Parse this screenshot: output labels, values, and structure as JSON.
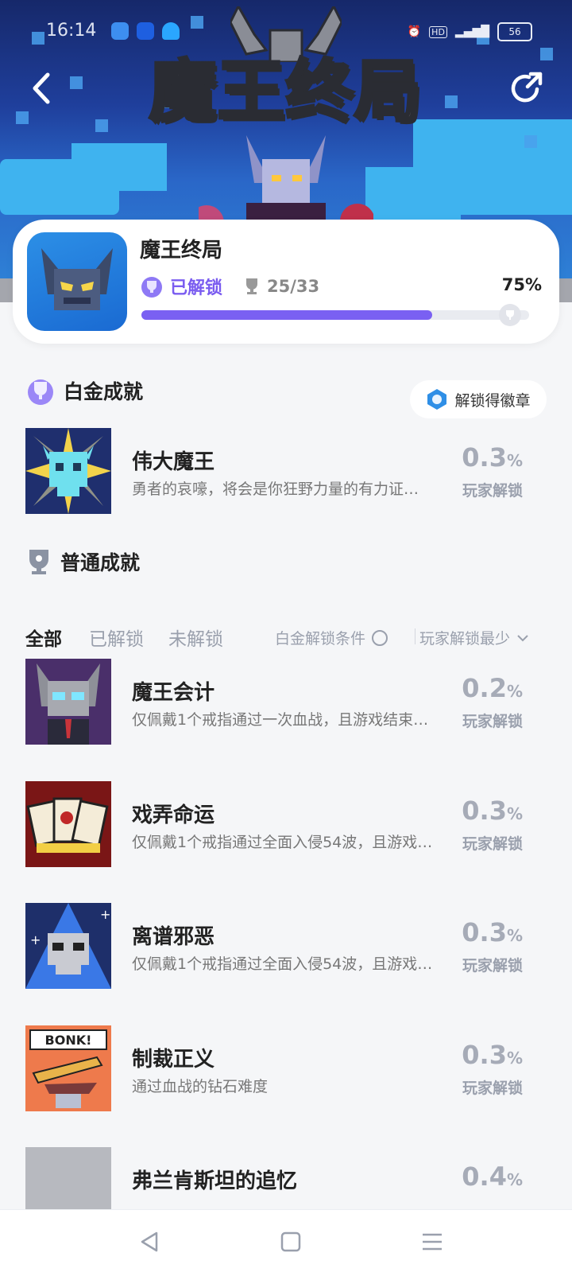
{
  "status_bar": {
    "time": "16:14",
    "battery": "56"
  },
  "hero": {
    "logo_text": "魔王终局"
  },
  "game": {
    "title": "魔王终局",
    "unlocked_label": "已解锁",
    "trophy_count": "25/33",
    "percent": "75%",
    "progress": 0.75
  },
  "platinum": {
    "heading": "白金成就",
    "badge_button": "解锁得徽章",
    "item": {
      "name": "伟大魔王",
      "desc": "勇者的哀嚎，将会是你狂野力量的有力证…",
      "rate": "0.3",
      "rate_unit": "%",
      "rate_label": "玩家解锁"
    }
  },
  "normal": {
    "heading": "普通成就",
    "tabs": [
      "全部",
      "已解锁",
      "未解锁"
    ],
    "filter_condition": "白金解锁条件",
    "sort": "玩家解锁最少",
    "items": [
      {
        "name": "魔王会计",
        "desc": "仅佩戴1个戒指通过一次血战，且游戏结束…",
        "rate": "0.2",
        "rate_unit": "%",
        "rate_label": "玩家解锁"
      },
      {
        "name": "戏弄命运",
        "desc": "仅佩戴1个戒指通过全面入侵54波，且游戏…",
        "rate": "0.3",
        "rate_unit": "%",
        "rate_label": "玩家解锁"
      },
      {
        "name": "离谱邪恶",
        "desc": "仅佩戴1个戒指通过全面入侵54波，且游戏…",
        "rate": "0.3",
        "rate_unit": "%",
        "rate_label": "玩家解锁"
      },
      {
        "name": "制裁正义",
        "desc": "通过血战的钻石难度",
        "rate": "0.3",
        "rate_unit": "%",
        "rate_label": "玩家解锁"
      },
      {
        "name": "弗兰肯斯坦的追忆",
        "desc": "",
        "rate": "0.4",
        "rate_unit": "%",
        "rate_label": ""
      }
    ]
  },
  "bonk_text": "BONK!"
}
